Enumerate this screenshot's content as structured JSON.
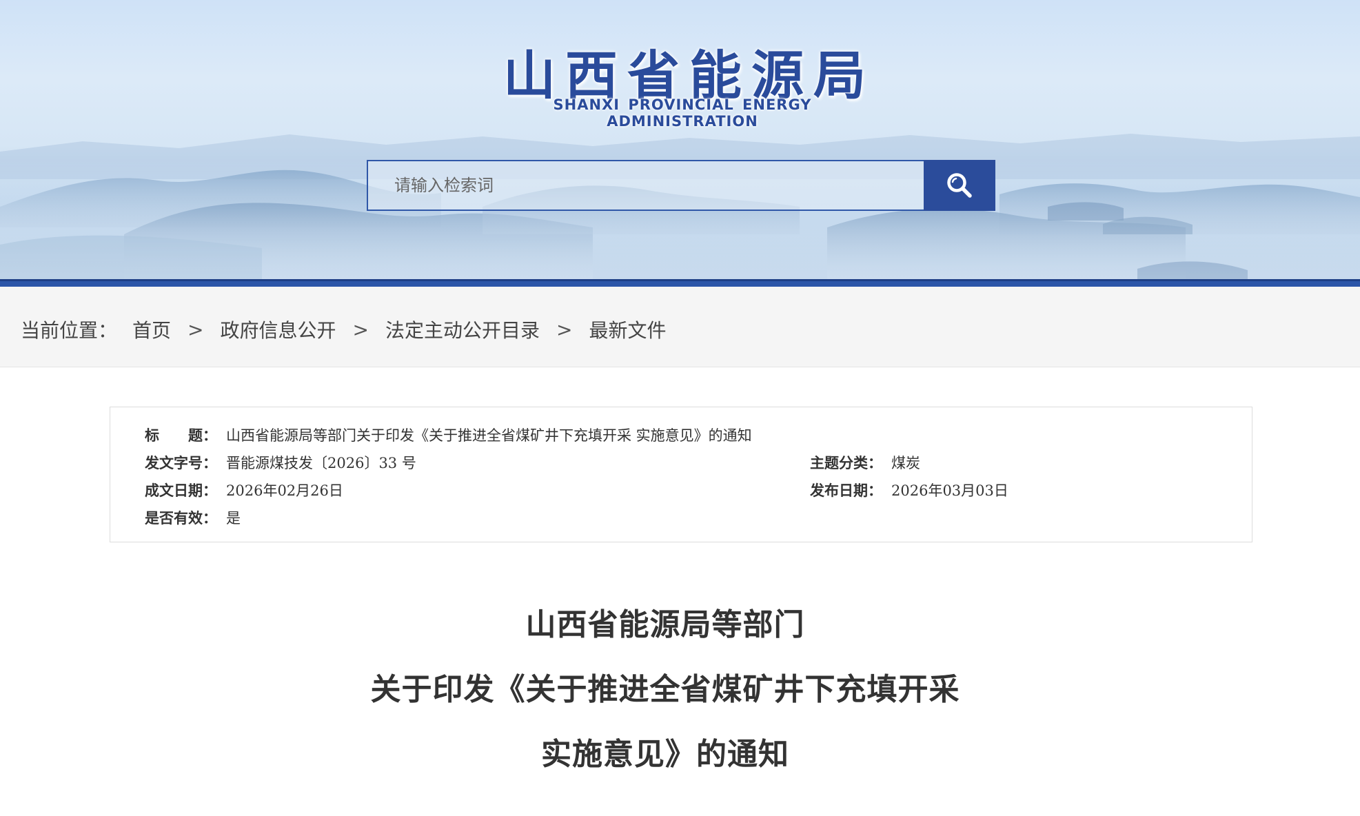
{
  "header": {
    "logo_cn": "山西省能源局",
    "logo_en": "SHANXI PROVINCIAL ENERGY ADMINISTRATION",
    "search_placeholder": "请输入检索词",
    "search_icon": "search-icon",
    "colors": {
      "brand_blue": "#2b4c9b",
      "rule_blue": "#2c55a8"
    }
  },
  "breadcrumb": {
    "lead": "当前位置：",
    "items": [
      "首页",
      "政府信息公开",
      "法定主动公开目录",
      "最新文件"
    ],
    "separator": ">"
  },
  "meta": {
    "title_label": "标　　题：",
    "title_value": "山西省能源局等部门关于印发《关于推进全省煤矿井下充填开采 实施意见》的通知",
    "doc_no_label": "发文字号：",
    "doc_no_value": "晋能源煤技发〔2026〕33 号",
    "topic_label": "主题分类：",
    "topic_value": "煤炭",
    "written_label": "成文日期：",
    "written_value": "2026年02月26日",
    "publish_label": "发布日期：",
    "publish_value": "2026年03月03日",
    "valid_label": "是否有效：",
    "valid_value": "是"
  },
  "document": {
    "title_lines": [
      "山西省能源局等部门",
      "关于印发《关于推进全省煤矿井下充填开采",
      "实施意见》的通知"
    ]
  }
}
